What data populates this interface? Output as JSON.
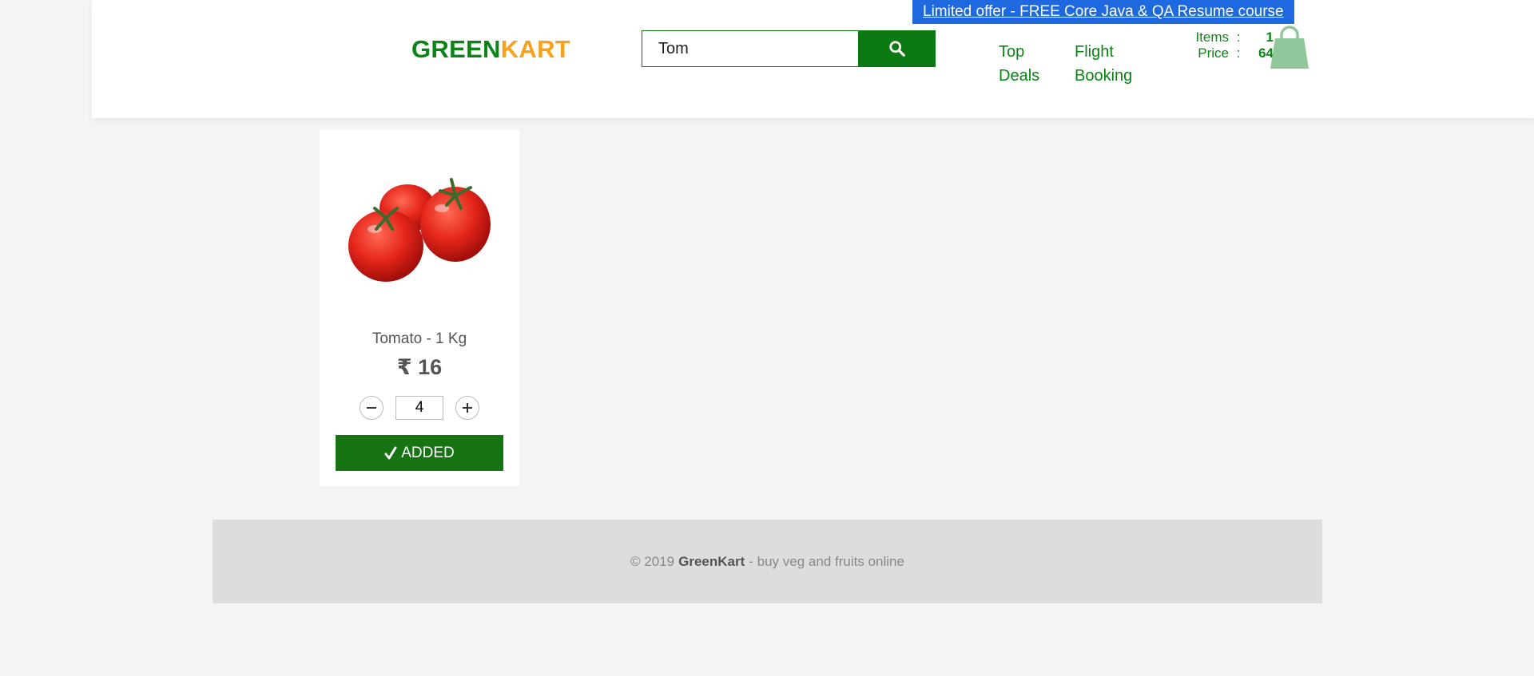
{
  "promo": {
    "text": "Limited offer - FREE Core Java & QA Resume course"
  },
  "brand": {
    "part1": "GREEN",
    "part2": "KART"
  },
  "search": {
    "value": "Tom",
    "button_icon": "search-icon"
  },
  "nav": {
    "top_deals": {
      "line1": "Top",
      "line2": "Deals"
    },
    "flight_booking": {
      "line1": "Flight",
      "line2": "Booking"
    }
  },
  "cart": {
    "items_label": "Items",
    "items_sep": ":",
    "items_value": "1",
    "price_label": "Price",
    "price_sep": ":",
    "price_value": "64",
    "icon": "shopping-bag-icon"
  },
  "product": {
    "name": "Tomato - 1 Kg",
    "currency": "₹",
    "price": "16",
    "quantity": "4",
    "decrement_icon": "minus-icon",
    "increment_icon": "plus-icon",
    "added_label": "ADDED",
    "added_icon": "check-icon"
  },
  "footer": {
    "copyright": "© 2019",
    "brand": "GreenKart",
    "tagline": "- buy veg and fruits online"
  },
  "colors": {
    "brand_green": "#0a8415",
    "brand_orange": "#f8a11a",
    "promo_blue": "#1e68e0",
    "button_green": "#177412"
  }
}
